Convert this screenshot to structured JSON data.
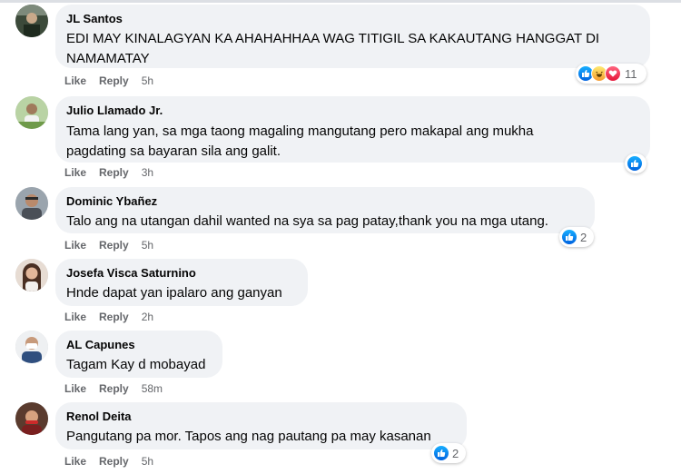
{
  "comments": [
    {
      "author": "JL Santos",
      "text_lines": [
        "EDI MAY KINALAGYAN KA AHAHAHHAA WAG TITIGIL SA KAKAUTANG HANGGAT DI",
        "NAMAMATAY"
      ],
      "like": "Like",
      "reply": "Reply",
      "time": "5h",
      "reactions": [
        "like",
        "haha",
        "love"
      ],
      "reaction_count": "11"
    },
    {
      "author": "Julio Llamado Jr.",
      "text_lines": [
        "Tama lang yan, sa mga taong magaling mangutang pero makapal ang mukha",
        "pagdating sa bayaran sila ang galit."
      ],
      "like": "Like",
      "reply": "Reply",
      "time": "3h",
      "reactions": [
        "like"
      ],
      "reaction_count": ""
    },
    {
      "author": "Dominic Ybañez",
      "text_lines": [
        "Talo ang na utangan dahil wanted na sya sa pag patay,thank you na mga utang."
      ],
      "like": "Like",
      "reply": "Reply",
      "time": "5h",
      "reactions": [
        "like"
      ],
      "reaction_count": "2"
    },
    {
      "author": "Josefa Visca Saturnino",
      "text_lines": [
        "Hnde dapat yan ipalaro ang ganyan"
      ],
      "like": "Like",
      "reply": "Reply",
      "time": "2h",
      "reactions": [],
      "reaction_count": ""
    },
    {
      "author": "AL Capunes",
      "text_lines": [
        "Tagam Kay d mobayad"
      ],
      "like": "Like",
      "reply": "Reply",
      "time": "58m",
      "reactions": [],
      "reaction_count": ""
    },
    {
      "author": "Renol Deita",
      "text_lines": [
        "Pangutang pa mor. Tapos ang nag pautang pa may kasanan"
      ],
      "like": "Like",
      "reply": "Reply",
      "time": "5h",
      "reactions": [
        "like"
      ],
      "reaction_count": "2"
    }
  ],
  "icons": {
    "like": "thumbs-up-icon",
    "haha": "laughing-face-icon",
    "love": "heart-icon"
  },
  "colors": {
    "bubble": "#f0f2f5",
    "meta": "#65676b",
    "like_blue": "#1877f2"
  }
}
